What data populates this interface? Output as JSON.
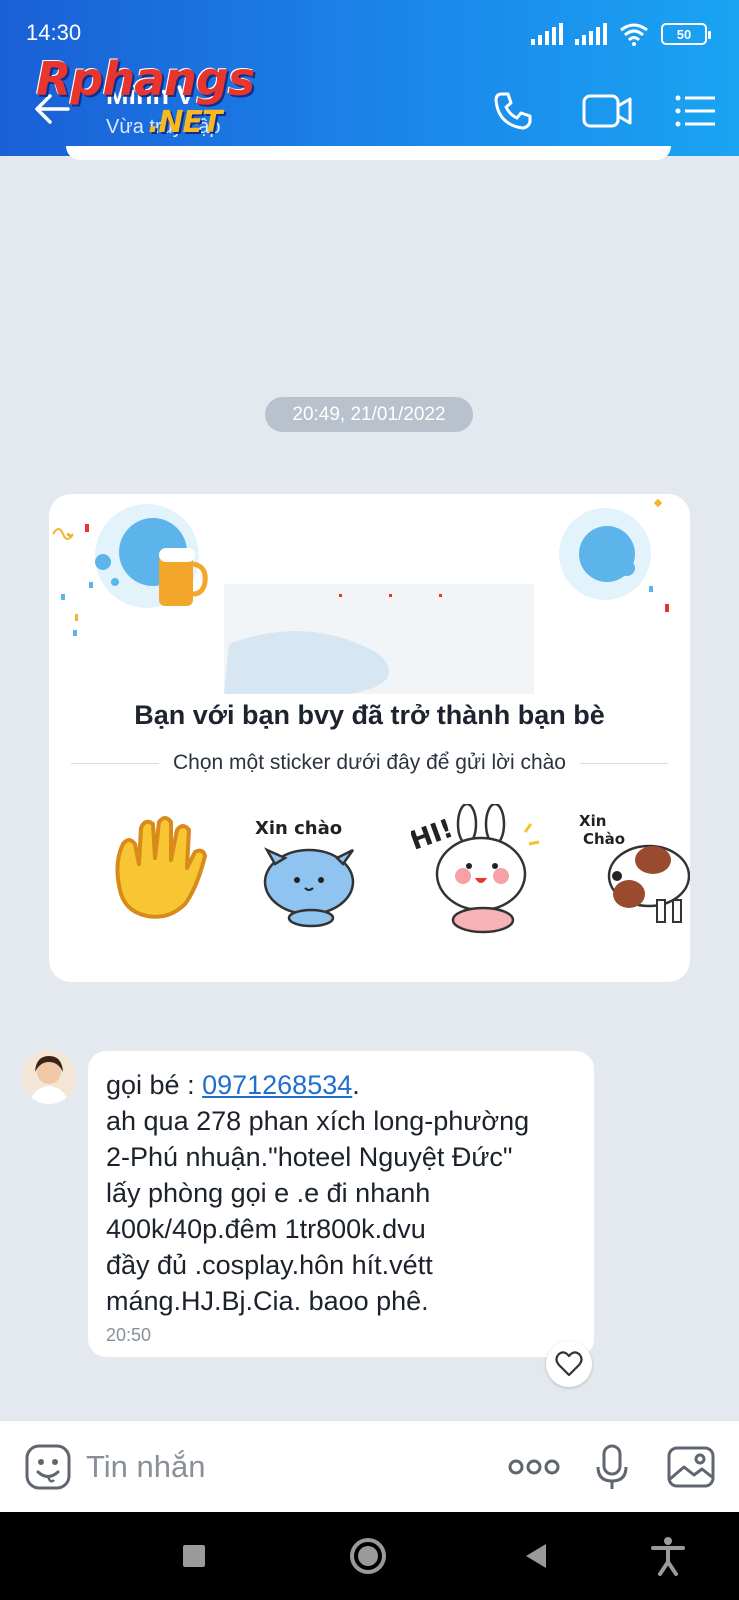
{
  "status_bar": {
    "time": "14:30",
    "battery": "50"
  },
  "watermark": {
    "main": "Rphangs",
    "sub": ".NET"
  },
  "header": {
    "contact_name": "Minh V",
    "contact_status": "Vừa truy cập"
  },
  "chat": {
    "date_separator": "20:49, 21/01/2022",
    "friend_card": {
      "title": "Bạn với bạn bvy đã trở thành bạn bè",
      "subtitle": "Chọn một sticker dưới đây để gửi lời chào",
      "stickers": [
        {
          "name": "waving-hand-icon"
        },
        {
          "name": "blue-cat-sticker",
          "caption": "Xin chào"
        },
        {
          "name": "bunny-hi-sticker",
          "caption": "HI!"
        },
        {
          "name": "puppy-bow-sticker",
          "caption": "Xin Chào"
        }
      ]
    },
    "message": {
      "prefix": "gọi bé : ",
      "phone": "0971268534",
      "suffix": ".",
      "lines": [
        "ah qua 278 phan xích long-phường",
        "2-Phú nhuận.\"hoteel Nguyệt Đức\"",
        "lấy phòng gọi e .e đi nhanh",
        "400k/40p.đêm 1tr800k.dvu",
        "đầy đủ .cosplay.hôn hít.vétt",
        "máng.HJ.Bj.Cia. baoo phê."
      ],
      "time": "20:50"
    }
  },
  "composer": {
    "placeholder": "Tin nhắn"
  },
  "colors": {
    "header_start": "#1a5fd6",
    "header_end": "#1aa4f2",
    "chat_bg": "#e4e9ef",
    "link": "#1f6fcf"
  }
}
